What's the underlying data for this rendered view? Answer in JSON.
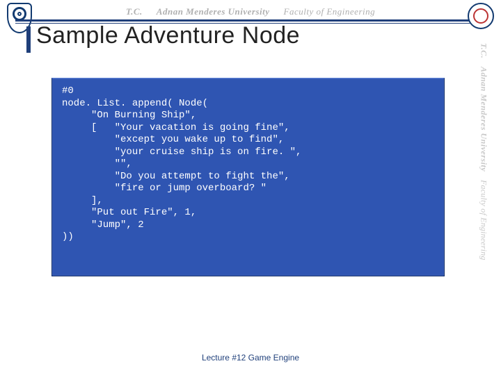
{
  "header": {
    "tc": "T.C.",
    "university": "Adnan Menderes University",
    "faculty": "Faculty of Engineering"
  },
  "sidebar": {
    "tc": "T.C.",
    "university": "Adnan Menderes University",
    "faculty": "Faculty of Engineering"
  },
  "title": "Sample Adventure Node",
  "code": "#0\nnode. List. append( Node(\n     \"On Burning Ship\",\n     [   \"Your vacation is going fine\",\n         \"except you wake up to find\",\n         \"your cruise ship is on fire. \",\n         \"\",\n         \"Do you attempt to fight the\",\n         \"fire or jump overboard? \"\n     ],\n     \"Put out Fire\", 1,\n     \"Jump\", 2\n))",
  "footer": "Lecture #12 Game Engine"
}
